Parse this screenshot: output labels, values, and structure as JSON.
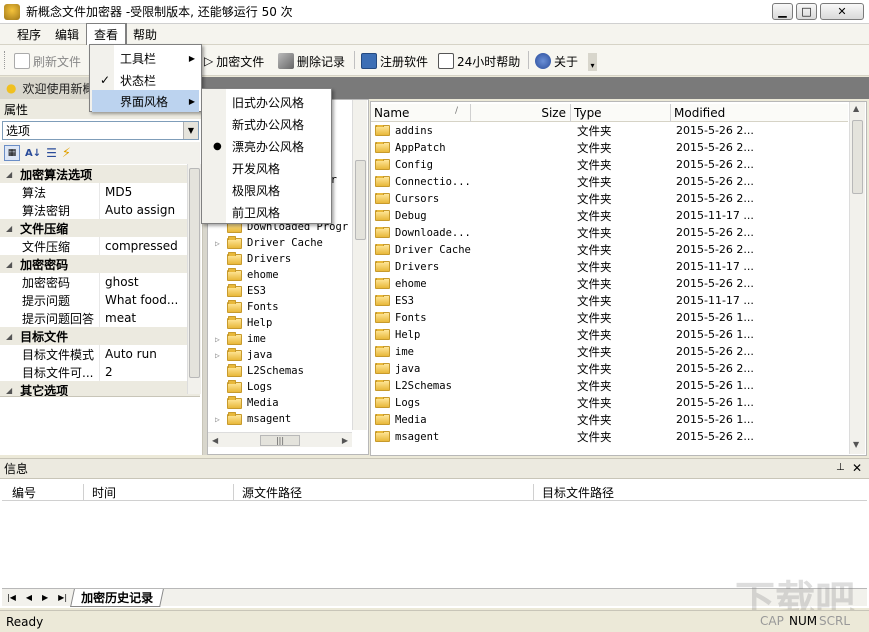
{
  "title": "新概念文件加密器 -受限制版本, 还能够运行 50 次",
  "menu": [
    "程序",
    "编辑",
    "查看",
    "帮助"
  ],
  "view_menu": {
    "items": [
      "工具栏",
      "状态栏",
      "界面风格"
    ],
    "checked": "状态栏"
  },
  "style_submenu": {
    "items": [
      "旧式办公风格",
      "新式办公风格",
      "漂亮办公风格",
      "开发风格",
      "极限风格",
      "前卫风格"
    ],
    "selected": "漂亮办公风格"
  },
  "toolbar": {
    "refresh": "刷新文件",
    "encrypt": "加密文件",
    "delete_record": "删除记录",
    "register": "注册软件",
    "help24": "24小时帮助",
    "about": "关于"
  },
  "welcome_tab": "欢迎使用新概",
  "properties": {
    "header": "属性",
    "selector": "选项",
    "categories": [
      {
        "name": "加密算法选项",
        "rows": [
          {
            "k": "算法",
            "v": "MD5"
          },
          {
            "k": "算法密钥",
            "v": "Auto assign"
          }
        ]
      },
      {
        "name": "文件压缩",
        "rows": [
          {
            "k": "文件压缩",
            "v": "compressed"
          }
        ]
      },
      {
        "name": "加密密码",
        "rows": [
          {
            "k": "加密密码",
            "v": "ghost"
          },
          {
            "k": "提示问题",
            "v": "What food..."
          },
          {
            "k": "提示问题回答",
            "v": "meat"
          }
        ]
      },
      {
        "name": "目标文件",
        "rows": [
          {
            "k": "目标文件模式",
            "v": "Auto run"
          },
          {
            "k": "目标文件可...",
            "v": "2"
          }
        ]
      },
      {
        "name": "其它选项",
        "rows": []
      }
    ]
  },
  "tree": {
    "partial_top": "zar",
    "items": [
      {
        "name": "Downloaded Progr",
        "exp": false
      },
      {
        "name": "Driver Cache",
        "exp": true
      },
      {
        "name": "Drivers",
        "exp": false
      },
      {
        "name": "ehome",
        "exp": false
      },
      {
        "name": "ES3",
        "exp": false
      },
      {
        "name": "Fonts",
        "exp": false
      },
      {
        "name": "Help",
        "exp": false
      },
      {
        "name": "ime",
        "exp": true
      },
      {
        "name": "java",
        "exp": true
      },
      {
        "name": "L2Schemas",
        "exp": false
      },
      {
        "name": "Logs",
        "exp": false
      },
      {
        "name": "Media",
        "exp": false
      },
      {
        "name": "msagent",
        "exp": true
      }
    ]
  },
  "file_list": {
    "columns": {
      "name": "Name",
      "size": "Size",
      "type": "Type",
      "modified": "Modified"
    },
    "rows": [
      {
        "name": "addins",
        "type": "文件夹",
        "modified": "2015-5-26 2..."
      },
      {
        "name": "AppPatch",
        "type": "文件夹",
        "modified": "2015-5-26 2..."
      },
      {
        "name": "Config",
        "type": "文件夹",
        "modified": "2015-5-26 2..."
      },
      {
        "name": "Connectio...",
        "type": "文件夹",
        "modified": "2015-5-26 2..."
      },
      {
        "name": "Cursors",
        "type": "文件夹",
        "modified": "2015-5-26 2..."
      },
      {
        "name": "Debug",
        "type": "文件夹",
        "modified": "2015-11-17 ..."
      },
      {
        "name": "Downloade...",
        "type": "文件夹",
        "modified": "2015-5-26 2..."
      },
      {
        "name": "Driver Cache",
        "type": "文件夹",
        "modified": "2015-5-26 2..."
      },
      {
        "name": "Drivers",
        "type": "文件夹",
        "modified": "2015-11-17 ..."
      },
      {
        "name": "ehome",
        "type": "文件夹",
        "modified": "2015-5-26 2..."
      },
      {
        "name": "ES3",
        "type": "文件夹",
        "modified": "2015-11-17 ..."
      },
      {
        "name": "Fonts",
        "type": "文件夹",
        "modified": "2015-5-26 1..."
      },
      {
        "name": "Help",
        "type": "文件夹",
        "modified": "2015-5-26 1..."
      },
      {
        "name": "ime",
        "type": "文件夹",
        "modified": "2015-5-26 2..."
      },
      {
        "name": "java",
        "type": "文件夹",
        "modified": "2015-5-26 2..."
      },
      {
        "name": "L2Schemas",
        "type": "文件夹",
        "modified": "2015-5-26 1..."
      },
      {
        "name": "Logs",
        "type": "文件夹",
        "modified": "2015-5-26 1..."
      },
      {
        "name": "Media",
        "type": "文件夹",
        "modified": "2015-5-26 1..."
      },
      {
        "name": "msagent",
        "type": "文件夹",
        "modified": "2015-5-26 2..."
      }
    ]
  },
  "info_panel": {
    "title": "信息",
    "columns": [
      "编号",
      "时间",
      "源文件路径",
      "目标文件路径"
    ],
    "tab": "加密历史记录"
  },
  "status": {
    "text": "Ready",
    "indicators": [
      "CAP",
      "NUM",
      "SCRL"
    ]
  },
  "watermark": "下载吧"
}
